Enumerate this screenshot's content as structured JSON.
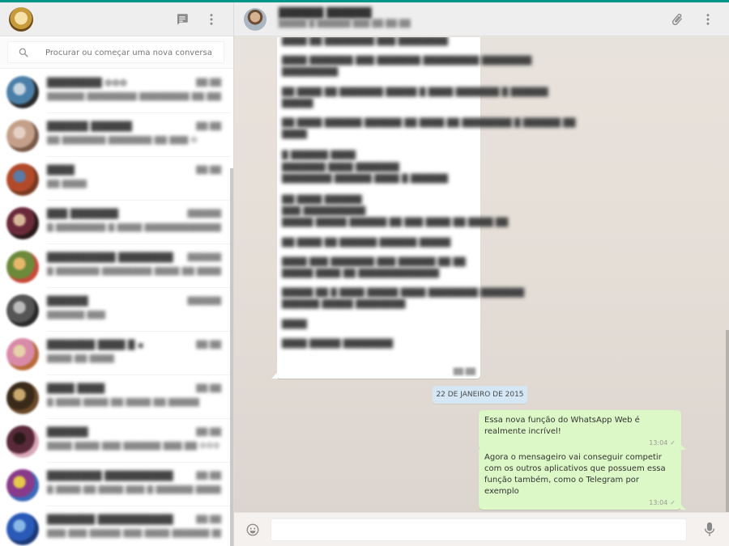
{
  "sidebar": {
    "header": {
      "new_chat_icon": "chat-icon",
      "menu_icon": "kebab-menu-icon"
    },
    "search": {
      "placeholder": "Procurar ou começar uma nova conversa"
    },
    "chats": [
      {
        "name": "████████ ✿✿✿",
        "time": "██:██",
        "preview": "██████ ████████ ████████ ██ ███████",
        "colors": [
          "#4a7fa8",
          "#2a2a2a",
          "#c8d6e0"
        ]
      },
      {
        "name": "██████ ██████",
        "time": "██:██",
        "preview": "██ ███████ ███████ ██ ███ ✿",
        "colors": [
          "#c4a08a",
          "#7a5a4a",
          "#e6d2c4"
        ]
      },
      {
        "name": "████",
        "time": "██:██",
        "preview": "██ ████",
        "colors": [
          "#b24a2a",
          "#7a3a20",
          "#5a7aa8"
        ]
      },
      {
        "name": "███ ███████",
        "time": "██████",
        "preview": "█ ████████ █ ████ █████████████",
        "colors": [
          "#6b2a3a",
          "#2a1a1a",
          "#d8b89a"
        ]
      },
      {
        "name": "██████████ ████████",
        "time": "██████",
        "preview": "█ ███████ ████████ ████ ██ ████ █",
        "colors": [
          "#6b8a3a",
          "#c84a3a",
          "#e6b86a"
        ]
      },
      {
        "name": "██████",
        "time": "██████",
        "preview": "██████ ███",
        "colors": [
          "#555555",
          "#2a2a2a",
          "#bbbbbb"
        ]
      },
      {
        "name": "███████ ████ █ ▪",
        "time": "██:██",
        "preview": "████ ██ ████",
        "colors": [
          "#d88aa8",
          "#b86a3a",
          "#e6d2a8"
        ]
      },
      {
        "name": "████ ████",
        "time": "██:██",
        "preview": "█ ████ ████ ██ ████ ██ █████",
        "colors": [
          "#3a2a1a",
          "#6b4a2a",
          "#c8a86a"
        ]
      },
      {
        "name": "██████",
        "time": "██:██",
        "preview": "████ ████ ███ ██████ ███ ██ ✿✿✿",
        "colors": [
          "#5a2a3a",
          "#d8a8b8",
          "#2a1a1a"
        ]
      },
      {
        "name": "████████ ██████████",
        "time": "██:██",
        "preview": "█ ████ ██ ████ ███ █ ██████ ████",
        "colors": [
          "#8a3a8a",
          "#3a6ab8",
          "#e6c84a"
        ]
      },
      {
        "name": "███████ ███████████",
        "time": "██:██",
        "preview": "███ ███ █████ ███ ████ ██████ ██",
        "colors": [
          "#2a5ab8",
          "#1a3a7a",
          "#8ab8e6"
        ]
      }
    ]
  },
  "main": {
    "header": {
      "name": "██████ ██████",
      "status": "█████ █ ██████ ███ ██ ██:██",
      "attach_icon": "paperclip-icon",
      "menu_icon": "kebab-menu-icon"
    },
    "received_lines": [
      "████ ██ ████████ ███ ████████",
      "████ ███████ ███ ███████ █████████ ████████",
      "█████████",
      "██ ████ ██ ███████ █████ █ ████ ███████ █ ██████",
      "█████",
      "██ ████ ██████ ██████ ██ ████ ██ ████████ █ ██████ ██",
      "████",
      "█ ██████ ████",
      "███████ ████ ███████",
      "████████ ██████ ████ █ ██████",
      "██ ████ ██████",
      "███ ██████████",
      "█████ █████ ██████ ██ ███ ████ ██ ████ ██",
      "██ ████ ██ ██████ ██████ █████",
      "████ ███ ███████ ███ ██████ ██ ██",
      "█████ ████ ██ █████████████",
      "█████ ██ █ ████ █████ ████ ████████ ███████",
      "██████ █████ ████████",
      "████",
      "████ █████ ████████"
    ],
    "received_time": "██:██",
    "date_chip": "22 DE JANEIRO DE 2015",
    "sent_messages": [
      {
        "text": "Essa nova função do WhatsApp Web é realmente incrível!",
        "time": "13:04",
        "status": "✓"
      },
      {
        "text": "Agora  o mensageiro vai conseguir competir com os outros aplicativos que possuem essa função também, como o Telegram por exemplo",
        "time": "13:04",
        "status": "✓"
      }
    ],
    "composer": {
      "placeholder": "",
      "emoji_icon": "smiley-icon",
      "mic_icon": "microphone-icon"
    }
  },
  "colors": {
    "accent": "#009688",
    "sent_bubble": "#dcf8c6",
    "received_bubble": "#ffffff",
    "date_chip": "#d5e7f5"
  }
}
